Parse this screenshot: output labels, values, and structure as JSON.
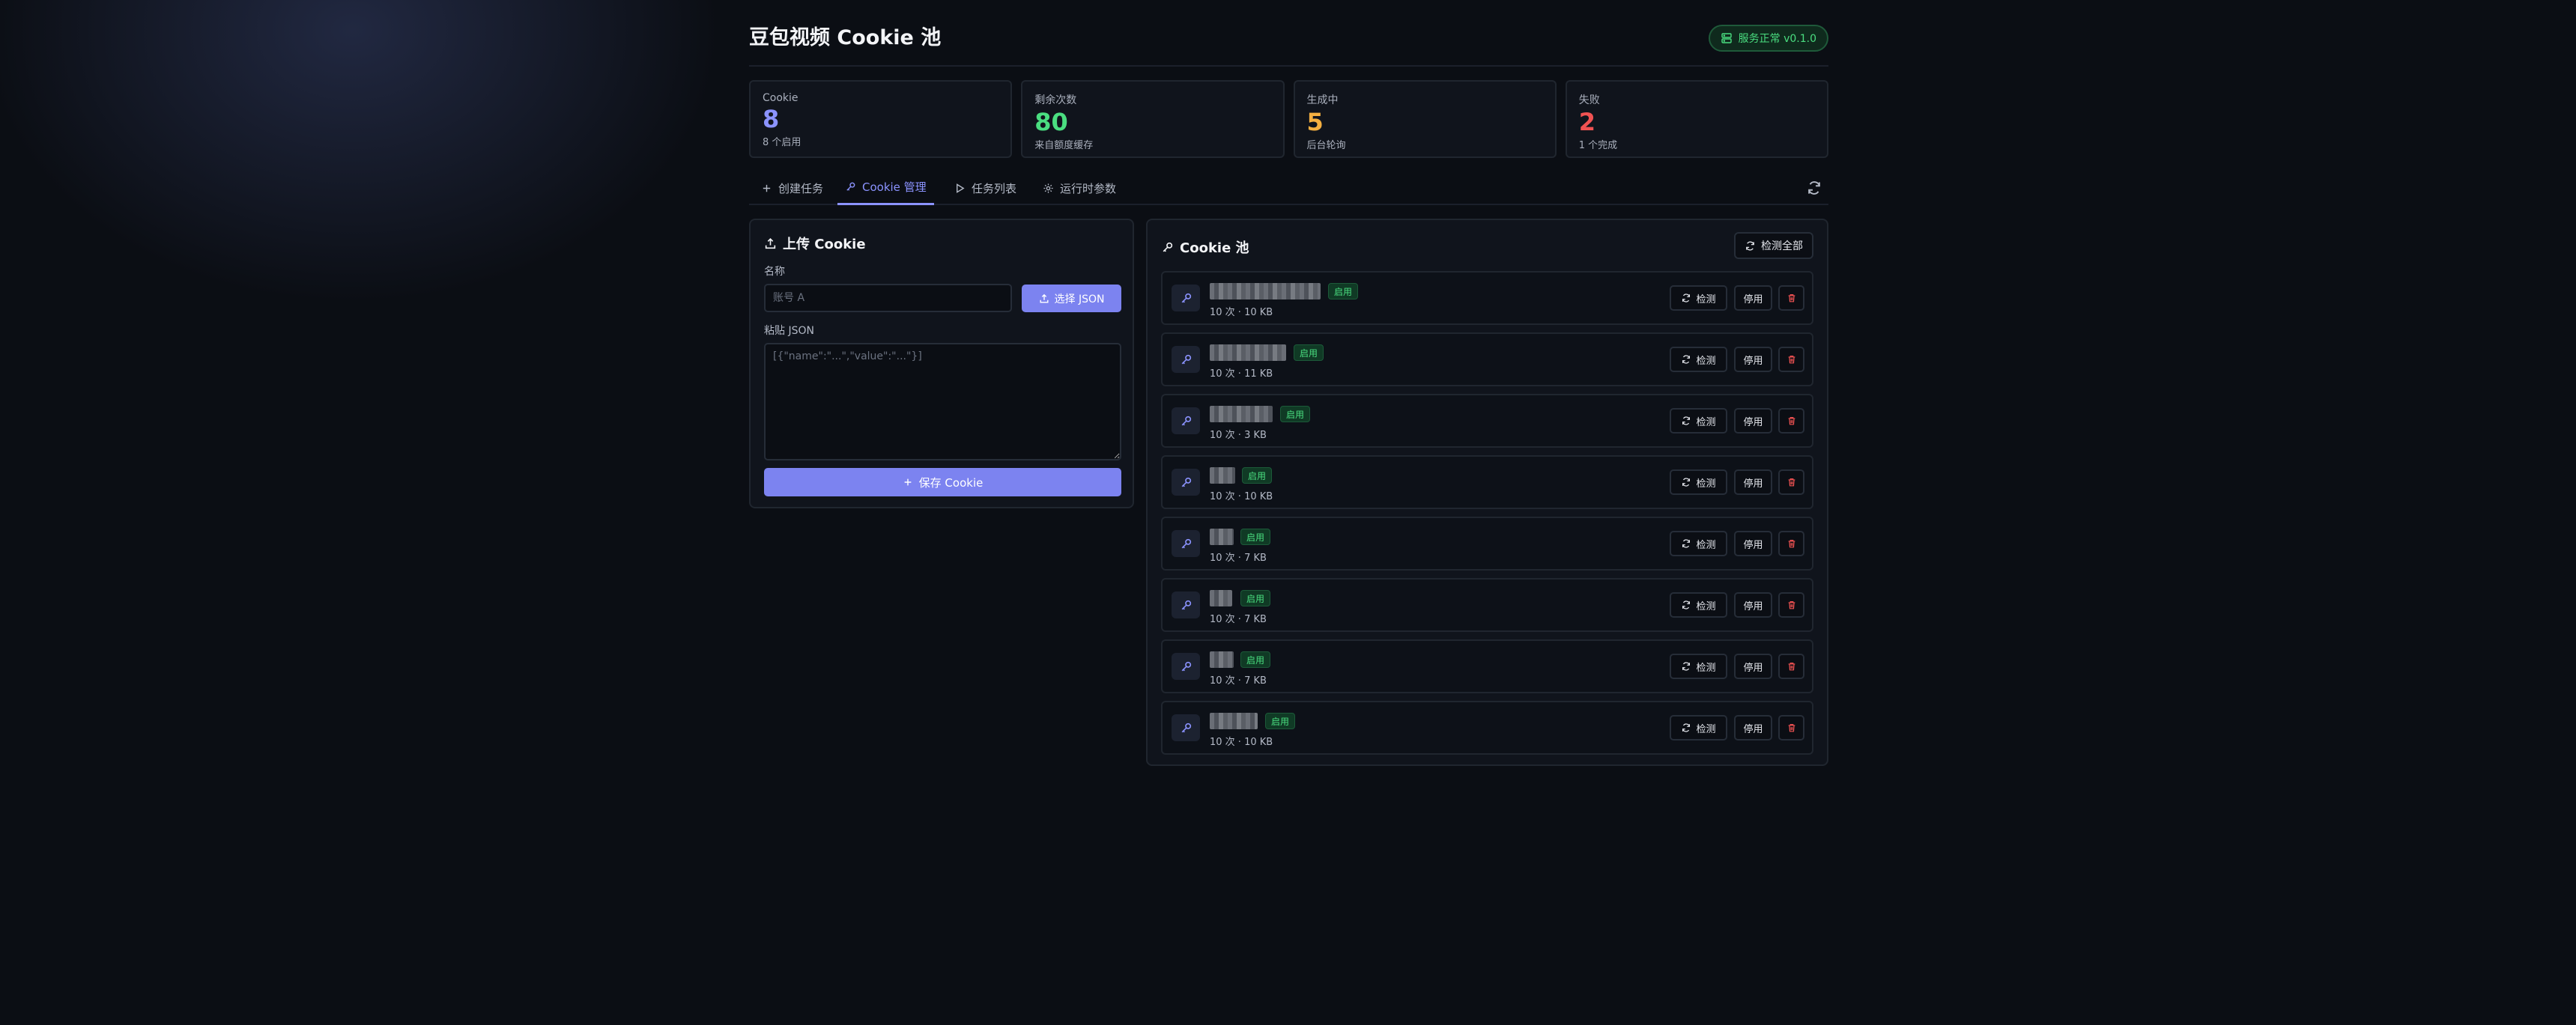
{
  "header": {
    "title": "豆包视频 Cookie 池",
    "status_label": "服务正常 v0.1.0"
  },
  "stats": [
    {
      "label": "Cookie",
      "value": "8",
      "sub": "8 个启用",
      "color": "#8b93ff"
    },
    {
      "label": "剩余次数",
      "value": "80",
      "sub": "来自额度缓存",
      "color": "#4ade80"
    },
    {
      "label": "生成中",
      "value": "5",
      "sub": "后台轮询",
      "color": "#f5b041"
    },
    {
      "label": "失败",
      "value": "2",
      "sub": "1 个完成",
      "color": "#f05252"
    }
  ],
  "tabs": [
    {
      "label": "创建任务",
      "icon": "plus-icon",
      "active": false
    },
    {
      "label": "Cookie 管理",
      "icon": "key-icon",
      "active": true
    },
    {
      "label": "任务列表",
      "icon": "play-icon",
      "active": false
    },
    {
      "label": "运行时参数",
      "icon": "gear-icon",
      "active": false
    }
  ],
  "upload": {
    "title": "上传 Cookie",
    "name_label": "名称",
    "name_placeholder": "账号 A",
    "choose_json_label": "选择 JSON",
    "paste_label": "粘贴 JSON",
    "json_placeholder": "[{\"name\":\"...\",\"value\":\"...\"}]",
    "save_label": "保存 Cookie"
  },
  "pool": {
    "title": "Cookie 池",
    "check_all_label": "检测全部",
    "check_label": "检测",
    "disable_label": "停用",
    "items": [
      {
        "status": "启用",
        "meta": "10 次 · 10 KB"
      },
      {
        "status": "启用",
        "meta": "10 次 · 11 KB"
      },
      {
        "status": "启用",
        "meta": "10 次 · 3 KB"
      },
      {
        "status": "启用",
        "meta": "10 次 · 10 KB"
      },
      {
        "status": "启用",
        "meta": "10 次 · 7 KB"
      },
      {
        "status": "启用",
        "meta": "10 次 · 7 KB"
      },
      {
        "status": "启用",
        "meta": "10 次 · 7 KB"
      },
      {
        "status": "启用",
        "meta": "10 次 · 10 KB"
      }
    ]
  },
  "colors": {
    "accent": "#7c83f0",
    "success": "#4ade80",
    "warning": "#f5b041",
    "danger": "#f05252",
    "background": "#0b0e14"
  }
}
